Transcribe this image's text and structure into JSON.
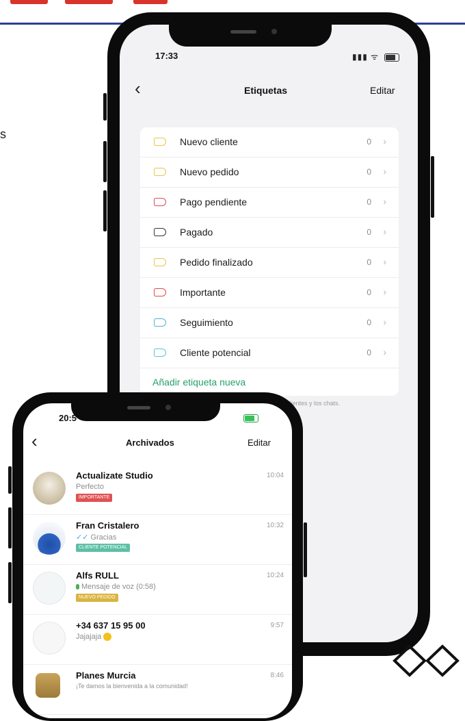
{
  "colors": {
    "brand_blue": "#2b3f92",
    "brand_red": "#d9342b",
    "accent_green": "#25a06a"
  },
  "side_text": "s",
  "labels_screen": {
    "status_time": "17:33",
    "nav": {
      "back_icon": "chevron-left-icon",
      "title": "Etiquetas",
      "edit": "Editar"
    },
    "labels": [
      {
        "name": "Nuevo cliente",
        "count": "0",
        "color": "#e4c64a"
      },
      {
        "name": "Nuevo pedido",
        "count": "0",
        "color": "#e4c64a"
      },
      {
        "name": "Pago pendiente",
        "count": "0",
        "color": "#d94b5b"
      },
      {
        "name": "Pagado",
        "count": "0",
        "color": "#333333"
      },
      {
        "name": "Pedido finalizado",
        "count": "0",
        "color": "#e4c64a"
      },
      {
        "name": "Importante",
        "count": "0",
        "color": "#e04848"
      },
      {
        "name": "Seguimiento",
        "count": "0",
        "color": "#4fb3d9"
      },
      {
        "name": "Cliente potencial",
        "count": "0",
        "color": "#5cc3d6"
      }
    ],
    "add_label": "Añadir etiqueta nueva",
    "footnote": "los clientes y los chats."
  },
  "chats_screen": {
    "status_time": "20:5",
    "nav": {
      "back_icon": "chevron-left-icon",
      "title": "Archivados",
      "edit": "Editar"
    },
    "chats": [
      {
        "name": "Actualizate Studio",
        "time": "10:04",
        "message": "Perfecto",
        "tag": "IMPORTANTE",
        "tag_color": "#e05252"
      },
      {
        "name": "Fran Cristalero",
        "time": "10:32",
        "message": "Gracias",
        "tag": "CLIENTE POTENCIAL",
        "tag_color": "#5dbfa5"
      },
      {
        "name": "Alfs RULL",
        "time": "10:24",
        "message": "Mensaje de voz (0:58)",
        "tag": "NUEVO PEDIDO",
        "tag_color": "#d9b441"
      },
      {
        "name": "+34 637 15 95 00",
        "time": "9:57",
        "message": "Jajajaja",
        "tag": "",
        "tag_color": ""
      },
      {
        "name": "Planes Murcia",
        "time": "8:46",
        "message": "¡Te damos la bienvenida a la comunidad!",
        "tag": "",
        "tag_color": ""
      }
    ]
  }
}
